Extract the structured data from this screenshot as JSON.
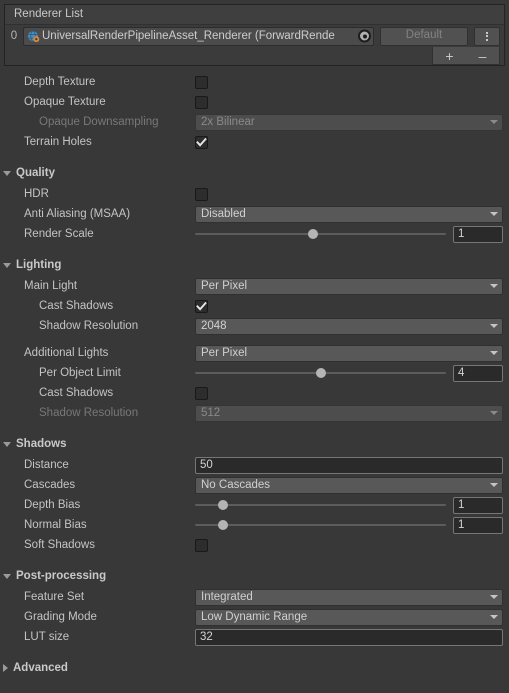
{
  "renderer_list": {
    "header_title": "Renderer List",
    "item": {
      "index": "0",
      "asset_name": "UniversalRenderPipelineAsset_Renderer (ForwardRende",
      "default_button": "Default",
      "picker_icon": "object-picker-icon",
      "kebab_icon": "more-options-icon"
    },
    "add_label": "+",
    "remove_label": "–"
  },
  "top_settings": [
    {
      "label": "Depth Texture",
      "type": "checkbox",
      "checked": false,
      "indent": 1,
      "disabled": false
    },
    {
      "label": "Opaque Texture",
      "type": "checkbox",
      "checked": false,
      "indent": 1,
      "disabled": false
    },
    {
      "label": "Opaque Downsampling",
      "type": "dropdown",
      "value": "2x Bilinear",
      "indent": 2,
      "disabled": true
    },
    {
      "label": "Terrain Holes",
      "type": "checkbox",
      "checked": true,
      "indent": 1,
      "disabled": false
    }
  ],
  "sections": [
    {
      "title": "Quality",
      "expanded": true,
      "rows": [
        {
          "label": "HDR",
          "type": "checkbox",
          "checked": false,
          "indent": 1,
          "disabled": false
        },
        {
          "label": "Anti Aliasing (MSAA)",
          "type": "dropdown",
          "value": "Disabled",
          "indent": 1,
          "disabled": false
        },
        {
          "label": "Render Scale",
          "type": "slider",
          "value": "1",
          "percent": 47,
          "indent": 1,
          "disabled": false
        }
      ]
    },
    {
      "title": "Lighting",
      "expanded": true,
      "rows": [
        {
          "label": "Main Light",
          "type": "dropdown",
          "value": "Per Pixel",
          "indent": 1,
          "disabled": false
        },
        {
          "label": "Cast Shadows",
          "type": "checkbox",
          "checked": true,
          "indent": 2,
          "disabled": false
        },
        {
          "label": "Shadow Resolution",
          "type": "dropdown",
          "value": "2048",
          "indent": 2,
          "disabled": false
        },
        {
          "label": "",
          "type": "gap",
          "indent": 0,
          "disabled": false
        },
        {
          "label": "Additional Lights",
          "type": "dropdown",
          "value": "Per Pixel",
          "indent": 1,
          "disabled": false
        },
        {
          "label": "Per Object Limit",
          "type": "slider",
          "value": "4",
          "percent": 50,
          "indent": 2,
          "disabled": false
        },
        {
          "label": "Cast Shadows",
          "type": "checkbox",
          "checked": false,
          "indent": 2,
          "disabled": false
        },
        {
          "label": "Shadow Resolution",
          "type": "dropdown",
          "value": "512",
          "indent": 2,
          "disabled": true
        }
      ]
    },
    {
      "title": "Shadows",
      "expanded": true,
      "rows": [
        {
          "label": "Distance",
          "type": "textfield",
          "value": "50",
          "indent": 1,
          "disabled": false
        },
        {
          "label": "Cascades",
          "type": "dropdown",
          "value": "No Cascades",
          "indent": 1,
          "disabled": false
        },
        {
          "label": "Depth Bias",
          "type": "slider",
          "value": "1",
          "percent": 11,
          "indent": 1,
          "disabled": false
        },
        {
          "label": "Normal Bias",
          "type": "slider",
          "value": "1",
          "percent": 11,
          "indent": 1,
          "disabled": false
        },
        {
          "label": "Soft Shadows",
          "type": "checkbox",
          "checked": false,
          "indent": 1,
          "disabled": false
        }
      ]
    },
    {
      "title": "Post-processing",
      "expanded": true,
      "rows": [
        {
          "label": "Feature Set",
          "type": "dropdown",
          "value": "Integrated",
          "indent": 1,
          "disabled": false
        },
        {
          "label": "Grading Mode",
          "type": "dropdown",
          "value": "Low Dynamic Range",
          "indent": 1,
          "disabled": false
        },
        {
          "label": "LUT size",
          "type": "textfield",
          "value": "32",
          "indent": 1,
          "disabled": false
        }
      ]
    },
    {
      "title": "Advanced",
      "expanded": false,
      "rows": []
    }
  ],
  "colors": {
    "window_bg": "#383838",
    "panel_bg": "#3b3b3b",
    "dropdown_bg": "#585858",
    "field_bg": "#2a2a2a",
    "text": "#c4c4c4",
    "text_disabled": "#787878"
  }
}
